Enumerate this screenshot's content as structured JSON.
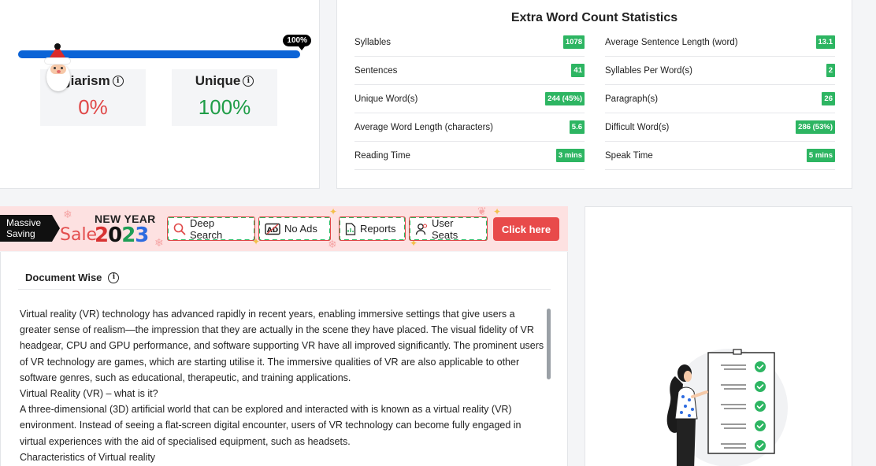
{
  "result": {
    "progress_label": "100%",
    "progress_value": 100,
    "plagiarism_label": "giarism",
    "plagiarism_value": "0%",
    "unique_label": "Unique",
    "unique_value": "100%"
  },
  "stats": {
    "title": "Extra Word Count Statistics",
    "left": [
      {
        "label": "Syllables",
        "value": "1078"
      },
      {
        "label": "Sentences",
        "value": "41"
      },
      {
        "label": "Unique Word(s)",
        "value": "244 (45%)"
      },
      {
        "label": "Average Word Length (characters)",
        "value": "5.6"
      },
      {
        "label": "Reading Time",
        "value": "3 mins"
      }
    ],
    "right": [
      {
        "label": "Average Sentence Length (word)",
        "value": "13.1"
      },
      {
        "label": "Syllables Per Word(s)",
        "value": "2"
      },
      {
        "label": "Paragraph(s)",
        "value": "26"
      },
      {
        "label": "Difficult Word(s)",
        "value": "286 (53%)"
      },
      {
        "label": "Speak Time",
        "value": "5 mins"
      }
    ]
  },
  "promo": {
    "massive_line1": "Massive",
    "massive_line2": "Saving",
    "new_year": "NEW YEAR",
    "sale": "Sale",
    "year_digits": [
      "2",
      "0",
      "2",
      "3"
    ],
    "features": {
      "deep_search": "Deep Search",
      "no_ads": "No Ads",
      "reports": "Reports",
      "user_seats": "User Seats"
    },
    "cta": "Click here"
  },
  "document": {
    "title": "Document Wise",
    "paragraphs": [
      "Virtual reality (VR) technology has advanced rapidly in recent years, enabling immersive settings that give users a greater sense of realism—the impression that they are actually in the scene they have placed. The visual fidelity of VR headgear, CPU and GPU performance, and software supporting VR have all improved significantly. The prominent users of VR technology are games, which are starting utilise it. The immersive qualities of VR are also applicable to other software genres, such as educational, therapeutic, and training applications.",
      "Virtual Reality (VR) – what is it?",
      "A three-dimensional (3D) artificial world that can be explored and interacted with is known as a virtual reality (VR) environment. Instead of seeing a flat-screen digital encounter, users of VR technology can become fully engaged in virtual experiences with the aid of specialised equipment, such as headsets.",
      "Characteristics of Virtual reality"
    ]
  },
  "colors": {
    "accent_blue": "#0a63d6",
    "green": "#2db562",
    "red": "#e04848",
    "promo_bg": "#fde1e1"
  }
}
